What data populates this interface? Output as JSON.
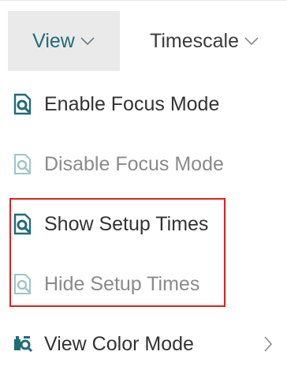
{
  "tabs": [
    {
      "label": "View",
      "icon": "chevron-down-icon"
    },
    {
      "label": "Timescale",
      "icon": "chevron-down-icon"
    }
  ],
  "menu": {
    "items": [
      {
        "label": "Enable Focus Mode",
        "icon": "focus-document-icon",
        "disabled": false
      },
      {
        "label": "Disable Focus Mode",
        "icon": "focus-document-icon",
        "disabled": true
      },
      {
        "label": "Show Setup Times",
        "icon": "focus-document-icon",
        "disabled": false
      },
      {
        "label": "Hide Setup Times",
        "icon": "focus-document-icon",
        "disabled": true
      },
      {
        "label": "View Color Mode",
        "icon": "color-mode-icon",
        "disabled": false,
        "submenu": "chevron-right-icon"
      }
    ]
  },
  "colors": {
    "accent": "#1f6c78",
    "icon_active": "#1f6c78",
    "icon_disabled": "#9fc4ca",
    "highlight": "#e02020",
    "tab_active_bg": "#eaeaea"
  }
}
